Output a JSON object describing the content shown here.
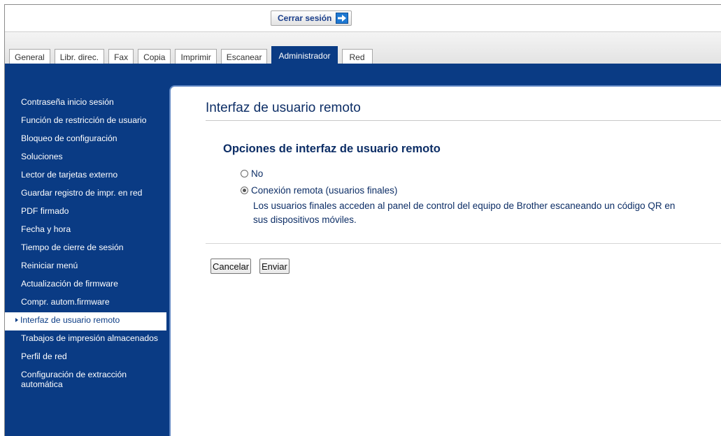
{
  "header": {
    "logout_label": "Cerrar sesión"
  },
  "tabs": [
    {
      "label": "General"
    },
    {
      "label": "Libr. direc."
    },
    {
      "label": "Fax"
    },
    {
      "label": "Copia"
    },
    {
      "label": "Imprimir"
    },
    {
      "label": "Escanear"
    },
    {
      "label": "Administrador",
      "active": true
    },
    {
      "label": "Red"
    }
  ],
  "sidebar": {
    "items": [
      {
        "label": "Contraseña inicio sesión"
      },
      {
        "label": "Función de restricción de usuario"
      },
      {
        "label": "Bloqueo de configuración"
      },
      {
        "label": "Soluciones"
      },
      {
        "label": "Lector de tarjetas externo"
      },
      {
        "label": "Guardar registro de impr. en red"
      },
      {
        "label": "PDF firmado"
      },
      {
        "label": "Fecha y hora"
      },
      {
        "label": "Tiempo de cierre de sesión"
      },
      {
        "label": "Reiniciar menú"
      },
      {
        "label": "Actualización de firmware"
      },
      {
        "label": "Compr. autom.firmware"
      },
      {
        "label": "Interfaz de usuario remoto",
        "active": true
      },
      {
        "label": "Trabajos de impresión almacenados"
      },
      {
        "label": "Perfil de red"
      },
      {
        "label": "Configuración de extracción automática"
      }
    ]
  },
  "main": {
    "title": "Interfaz de usuario remoto",
    "section_title": "Opciones de interfaz de usuario remoto",
    "options": [
      {
        "label": "No",
        "checked": false
      },
      {
        "label": "Conexión remota (usuarios finales)",
        "checked": true
      }
    ],
    "description": "Los usuarios finales acceden al panel de control del equipo de Brother escaneando un código QR en sus dispositivos móviles.",
    "cancel_label": "Cancelar",
    "submit_label": "Enviar"
  },
  "colors": {
    "brand_blue": "#0a3b84",
    "text_blue": "#0d2e66"
  },
  "icons": {
    "logout": "arrow-right-icon",
    "active_item": "triangle-right-icon"
  }
}
